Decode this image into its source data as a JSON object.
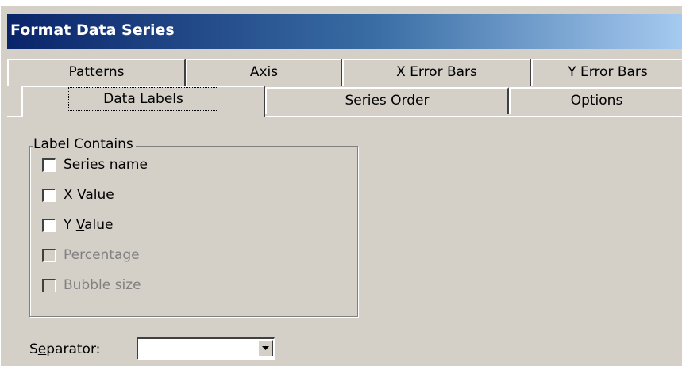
{
  "window": {
    "title": "Format Data Series"
  },
  "tabs": {
    "row1": [
      "Patterns",
      "Axis",
      "X Error Bars",
      "Y Error Bars"
    ],
    "row2": [
      "Data Labels",
      "Series Order",
      "Options"
    ],
    "active": "Data Labels"
  },
  "label_contains": {
    "legend": "Label Contains",
    "options": [
      {
        "label": "Series name",
        "mnemonic": "S",
        "rest": "eries name",
        "prefix": "",
        "checked": false,
        "enabled": true
      },
      {
        "label": "X Value",
        "mnemonic": "X",
        "rest": " Value",
        "prefix": "",
        "checked": false,
        "enabled": true
      },
      {
        "label": "Y Value",
        "mnemonic": "V",
        "rest": "alue",
        "prefix": "Y ",
        "checked": false,
        "enabled": true
      },
      {
        "label": "Percentage",
        "checked": false,
        "enabled": false
      },
      {
        "label": "Bubble size",
        "checked": false,
        "enabled": false
      }
    ]
  },
  "separator": {
    "label_prefix": "S",
    "label_mnemonic": "e",
    "label_rest": "parator:",
    "label": "Separator:",
    "value": ""
  },
  "icons": {
    "combo_arrow": "chevron-down-icon"
  }
}
